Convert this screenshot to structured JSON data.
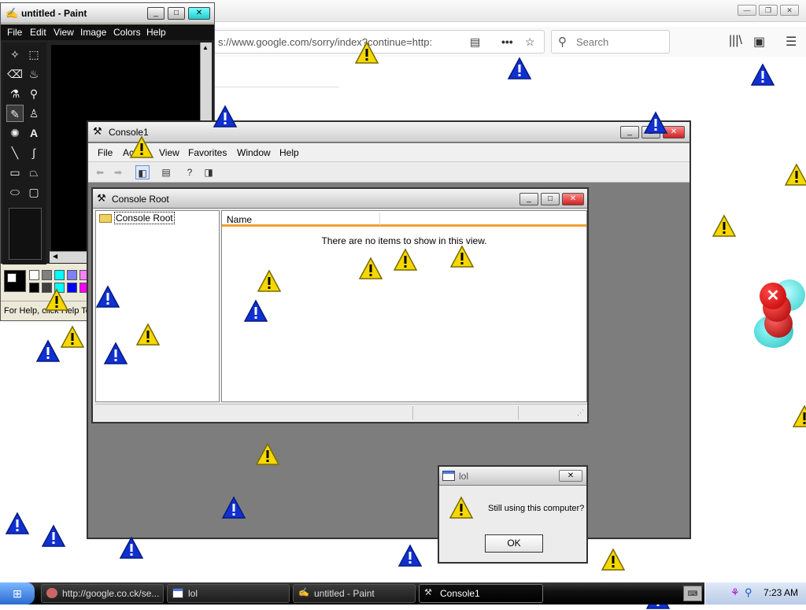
{
  "browser": {
    "url": "s://www.google.com/sorry/index?continue=http:",
    "search_placeholder": "Search",
    "window_controls": [
      "minimize",
      "restore",
      "close"
    ]
  },
  "paint": {
    "title": "untitled - Paint",
    "menu": [
      "File",
      "Edit",
      "View",
      "Image",
      "Colors",
      "Help"
    ],
    "status": "For Help, click Help To",
    "palette_colors": [
      "#ffffff",
      "#808080",
      "#00ffff",
      "#8080ff",
      "#ff80ff",
      "#000000",
      "#404040",
      "#00ffff",
      "#0000ff",
      "#ff00ff"
    ]
  },
  "console1": {
    "title": "Console1",
    "menu": [
      "File",
      "Action",
      "View",
      "Favorites",
      "Window",
      "Help"
    ]
  },
  "console_root": {
    "title": "Console Root",
    "tree_item": "Console Root",
    "column_name": "Name",
    "empty_message": "There are no items to show in this view."
  },
  "dialog": {
    "title": "lol",
    "message": "Still using this computer?",
    "ok_label": "OK",
    "close_label": "✕"
  },
  "taskbar": {
    "tasks": [
      {
        "label": "http://google.co.ck/se...",
        "icon": "firefox-icon"
      },
      {
        "label": "lol",
        "icon": "window-icon"
      },
      {
        "label": "untitled - Paint",
        "icon": "paint-icon"
      },
      {
        "label": "Console1",
        "icon": "mmc-icon"
      }
    ],
    "clock": "7:23 AM"
  },
  "colors": {
    "warning_yellow": "#f5d800",
    "info_blue": "#1030d0",
    "console_gray": "#7d7d7d"
  }
}
